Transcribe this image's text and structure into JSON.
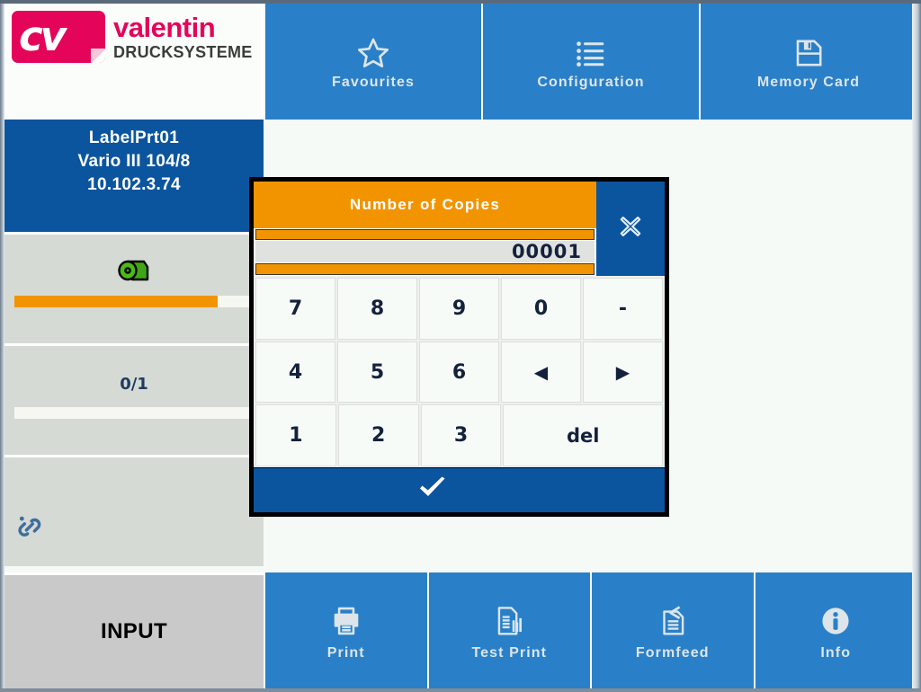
{
  "header": {
    "logo": {
      "mark_text": "cv",
      "brand": "valentin",
      "subtitle": "DRUCKSYSTEME"
    },
    "nav": [
      {
        "label": "Favourites",
        "icon": "star-icon"
      },
      {
        "label": "Configuration",
        "icon": "list-icon"
      },
      {
        "label": "Memory Card",
        "icon": "floppy-disk-icon"
      }
    ]
  },
  "sidebar": {
    "printer": {
      "name": "LabelPrt01",
      "model": "Vario III 104/8",
      "ip": "10.102.3.74"
    },
    "panels": [
      {
        "name": "ribbon-status",
        "icon": "ribbon-roll-icon",
        "progress_percent": 85,
        "bar_color": "#F29400"
      },
      {
        "name": "job-counter",
        "value": "0/1",
        "progress_percent": 0,
        "bar_color": "#F29400"
      },
      {
        "name": "network-link",
        "icon": "link-chain-icon"
      }
    ]
  },
  "footer": {
    "input_label": "INPUT",
    "actions": [
      {
        "label": "Print",
        "icon": "printer-icon"
      },
      {
        "label": "Test Print",
        "icon": "test-print-icon"
      },
      {
        "label": "Formfeed",
        "icon": "formfeed-icon"
      },
      {
        "label": "Info",
        "icon": "info-icon"
      }
    ]
  },
  "dialog": {
    "title": "Number of Copies",
    "value": "00001",
    "increment_label": "",
    "decrement_label": "",
    "close_icon": "close-x-icon",
    "confirm_icon": "checkmark-icon",
    "keypad_rows": [
      [
        {
          "label": "7",
          "type": "digit",
          "span": 1
        },
        {
          "label": "8",
          "type": "digit",
          "span": 1
        },
        {
          "label": "9",
          "type": "digit",
          "span": 1
        },
        {
          "label": "0",
          "type": "digit",
          "span": 1
        },
        {
          "label": "-",
          "type": "minus",
          "span": 1
        }
      ],
      [
        {
          "label": "4",
          "type": "digit",
          "span": 1
        },
        {
          "label": "5",
          "type": "digit",
          "span": 1
        },
        {
          "label": "6",
          "type": "digit",
          "span": 1
        },
        {
          "label": "◀",
          "type": "arrow-left",
          "span": 1
        },
        {
          "label": "▶",
          "type": "arrow-right",
          "span": 1
        }
      ],
      [
        {
          "label": "1",
          "type": "digit",
          "span": 1
        },
        {
          "label": "2",
          "type": "digit",
          "span": 1
        },
        {
          "label": "3",
          "type": "digit",
          "span": 1
        },
        {
          "label": "del",
          "type": "delete",
          "span": 2
        }
      ]
    ]
  },
  "colors": {
    "nav_blue": "#2980C8",
    "deep_blue": "#0B559F",
    "orange": "#F29400",
    "panel_grey": "#D5DAD5",
    "background": "#F5FAF6",
    "brand_magenta": "#E4055B",
    "text_navy": "#14213D"
  }
}
